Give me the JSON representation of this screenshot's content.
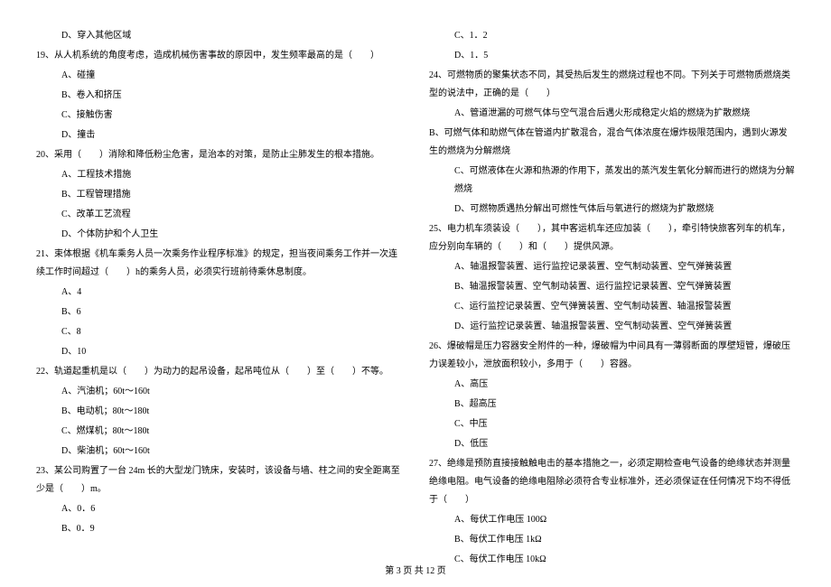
{
  "left": {
    "q18d": "D、穿入其他区域",
    "q19": "19、从人机系统的角度考虑，造成机械伤害事故的原因中，发生频率最高的是（　　）",
    "q19a": "A、碰撞",
    "q19b": "B、卷入和挤压",
    "q19c": "C、接触伤害",
    "q19d": "D、撞击",
    "q20": "20、采用（　　）消除和降低粉尘危害，是治本的对策，是防止尘肺发生的根本措施。",
    "q20a": "A、工程技术措施",
    "q20b": "B、工程管理措施",
    "q20c": "C、改革工艺流程",
    "q20d": "D、个体防护和个人卫生",
    "q21": "21、束体根据《机车乘务人员一次乘务作业程序标准》的规定，担当夜间乘务工作并一次连续工作时间超过（　　）h的乘务人员，必须实行班前待乘休息制度。",
    "q21a": "A、4",
    "q21b": "B、6",
    "q21c": "C、8",
    "q21d": "D、10",
    "q22": "22、轨道起重机是以（　　）为动力的起吊设备，起吊吨位从（　　）至（　　）不等。",
    "q22a": "A、汽油机；60t～160t",
    "q22b": "B、电动机；80t～180t",
    "q22c": "C、燃煤机；80t～180t",
    "q22d": "D、柴油机；60t～160t",
    "q23": "23、某公司购置了一台 24m 长的大型龙门铣床，安装时，该设备与墙、柱之间的安全距离至少是（　　）m。",
    "q23a": "A、0．6",
    "q23b": "B、0．9"
  },
  "right": {
    "q23c": "C、1．2",
    "q23d": "D、1．5",
    "q24": "24、可燃物质的聚集状态不同，其受热后发生的燃烧过程也不同。下列关于可燃物质燃烧类型的说法中，正确的是（　　）",
    "q24a": "A、管道泄漏的可燃气体与空气混合后遇火形成稳定火焰的燃烧为扩散燃烧",
    "q24b": "B、可燃气体和助燃气体在管道内扩散混合，混合气体浓度在爆炸极限范围内，遇到火源发生的燃烧为分解燃烧",
    "q24c": "C、可燃液体在火源和热源的作用下，蒸发出的蒸汽发生氧化分解而进行的燃烧为分解燃烧",
    "q24d": "D、可燃物质遇热分解出可燃性气体后与氧进行的燃烧为扩散燃烧",
    "q25": "25、电力机车须装设（　　），其中客运机车还应加装（　　），牵引特快旅客列车的机车，应分别向车辆的（　　）和（　　）提供风源。",
    "q25a": "A、轴温报警装置、运行监控记录装置、空气制动装置、空气弹簧装置",
    "q25b": "B、轴温报警装置、空气制动装置、运行监控记录装置、空气弹簧装置",
    "q25c": "C、运行监控记录装置、空气弹簧装置、空气制动装置、轴温报警装置",
    "q25d": "D、运行监控记录装置、轴温报警装置、空气制动装置、空气弹簧装置",
    "q26": "26、爆破帽是压力容器安全附件的一种，爆破帽为中间具有一薄弱断面的厚壁短管，爆破压力误差较小，泄放面积较小，多用于（　　）容器。",
    "q26a": "A、高压",
    "q26b": "B、超高压",
    "q26c": "C、中压",
    "q26d": "D、低压",
    "q27": "27、绝缘是预防直接接触触电击的基本措施之一，必须定期检查电气设备的绝缘状态并测量绝缘电阻。电气设备的绝缘电阻除必须符合专业标准外，还必须保证在任何情况下均不得低于（　　）",
    "q27a": "A、每伏工作电压 100Ω",
    "q27b": "B、每伏工作电压 1kΩ",
    "q27c": "C、每伏工作电压 10kΩ"
  },
  "footer": "第 3 页 共 12 页"
}
